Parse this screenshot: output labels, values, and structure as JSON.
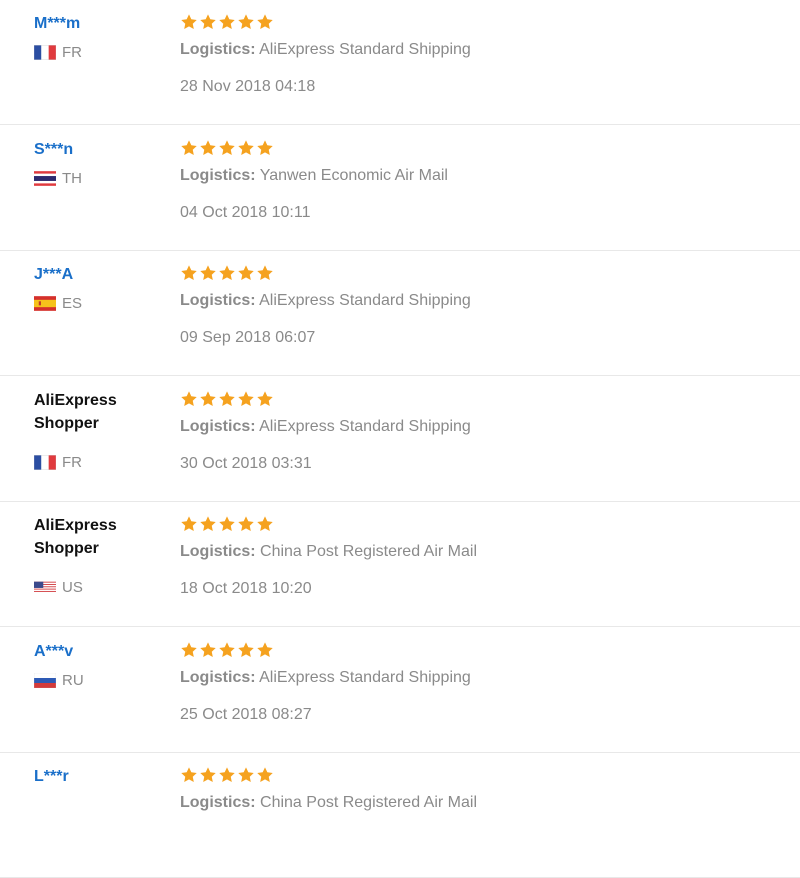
{
  "reviews": [
    {
      "user": "M***m",
      "masked": true,
      "country": "FR",
      "flag": "fr",
      "stars": 5,
      "logistics_label": "Logistics:",
      "logistics": "AliExpress Standard Shipping",
      "date": "28 Nov 2018 04:18"
    },
    {
      "user": "S***n",
      "masked": true,
      "country": "TH",
      "flag": "th",
      "stars": 5,
      "logistics_label": "Logistics:",
      "logistics": "Yanwen Economic Air Mail",
      "date": "04 Oct 2018 10:11"
    },
    {
      "user": "J***A",
      "masked": true,
      "country": "ES",
      "flag": "es",
      "stars": 5,
      "logistics_label": "Logistics:",
      "logistics": "AliExpress Standard Shipping",
      "date": "09 Sep 2018 06:07"
    },
    {
      "user": "AliExpress Shopper",
      "masked": false,
      "country": "FR",
      "flag": "fr",
      "stars": 5,
      "logistics_label": "Logistics:",
      "logistics": "AliExpress Standard Shipping",
      "date": "30 Oct 2018 03:31"
    },
    {
      "user": "AliExpress Shopper",
      "masked": false,
      "country": "US",
      "flag": "us",
      "stars": 5,
      "logistics_label": "Logistics:",
      "logistics": "China Post Registered Air Mail",
      "date": "18 Oct 2018 10:20"
    },
    {
      "user": "A***v",
      "masked": true,
      "country": "RU",
      "flag": "ru",
      "stars": 5,
      "logistics_label": "Logistics:",
      "logistics": "AliExpress Standard Shipping",
      "date": "25 Oct 2018 08:27"
    },
    {
      "user": "L***r",
      "masked": true,
      "country": "",
      "flag": "",
      "stars": 5,
      "logistics_label": "Logistics:",
      "logistics": "China Post Registered Air Mail",
      "date": ""
    }
  ],
  "colors": {
    "star": "#f5a21f",
    "link": "#1a6fc9",
    "muted": "#8a8a8a"
  }
}
